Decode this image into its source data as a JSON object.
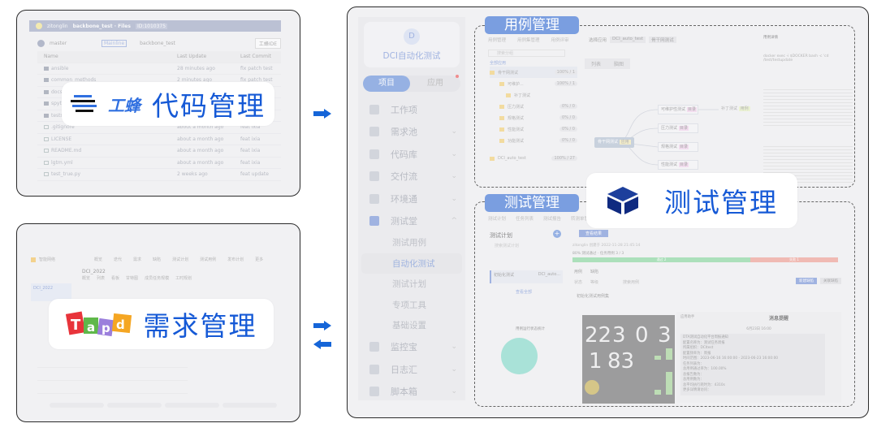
{
  "code_panel": {
    "breadcrumb": {
      "user": "zitonglin",
      "repo": "backbone_test · Files",
      "id": "ID:1010375"
    },
    "branch": "master",
    "branch_tag": "Mainline",
    "path": "backbone_test",
    "ide_button": "工蜂IDE",
    "columns": [
      "Name",
      "Last Update",
      "Last Commit"
    ],
    "commit_hash": "e40f",
    "files": [
      {
        "name": "ansible",
        "type": "folder",
        "updated": "28 minutes ago",
        "commit": "fix patch test"
      },
      {
        "name": "common_methods",
        "type": "folder",
        "updated": "2 minutes ago",
        "commit": "fix patch test"
      },
      {
        "name": "docs",
        "type": "folder",
        "updated": "",
        "commit": ""
      },
      {
        "name": "spytest",
        "type": "folder",
        "updated": "",
        "commit": ""
      },
      {
        "name": "tests",
        "type": "folder",
        "updated": "",
        "commit": ""
      },
      {
        "name": ".gitignore",
        "type": "file",
        "updated": "about a month ago",
        "commit": "feat ixia"
      },
      {
        "name": "LICENSE",
        "type": "file",
        "updated": "about a month ago",
        "commit": "feat ixia"
      },
      {
        "name": "README.md",
        "type": "file",
        "updated": "about a month ago",
        "commit": "feat ixia"
      },
      {
        "name": "lgtm.yml",
        "type": "file",
        "updated": "about a month ago",
        "commit": "feat ixia"
      },
      {
        "name": "test_true.py",
        "type": "file",
        "updated": "2 weeks ago",
        "commit": "feat update"
      }
    ],
    "overlay": {
      "logo": "工蜂",
      "title": "代码管理"
    }
  },
  "req_panel": {
    "app_name": "智能网络",
    "nav": [
      "概览",
      "迭代",
      "需求",
      "缺陷",
      "测试计划",
      "测试用例",
      "发布计划",
      "更多"
    ],
    "sprint": "DCI_2022",
    "tabs": [
      "概览",
      "列表",
      "看板",
      "甘特图",
      "成员任务规模",
      "工时规划"
    ],
    "overlay": {
      "logo": "Tapd",
      "title": "需求管理"
    }
  },
  "platform": {
    "project_initial": "D",
    "project_name": "DCI自动化测试",
    "toggle": [
      "项目",
      "应用"
    ],
    "menu": [
      {
        "label": "工作项",
        "chevron": false
      },
      {
        "label": "需求池",
        "chevron": true
      },
      {
        "label": "代码库",
        "chevron": true
      },
      {
        "label": "交付流",
        "chevron": true
      },
      {
        "label": "环境通",
        "chevron": true
      },
      {
        "label": "测试堂",
        "chevron": true,
        "expanded": true
      }
    ],
    "submenu": [
      "测试用例",
      "自动化测试",
      "测试计划",
      "专项工具",
      "基础设置"
    ],
    "active_sub": "自动化测试",
    "menu_bottom": [
      "监控宝",
      "日志汇",
      "脚本箱"
    ],
    "accent": "#6f96dc"
  },
  "case_section": {
    "label": "用例管理",
    "tabs": [
      "用例管理",
      "用例集管理",
      "用例评审"
    ],
    "app_select_label": "选择应用",
    "app_chips": [
      "DCI_auto_test",
      "骨干网测试"
    ],
    "search_placeholder": "搜索分组",
    "all_apps": "全部应用",
    "tree": [
      {
        "name": "骨干网测试",
        "pct": "100% / 1"
      },
      {
        "name": "可维护...",
        "pct": "100% / 1"
      },
      {
        "name": "补丁测试",
        "pct": ""
      },
      {
        "name": "压力测试",
        "pct": "0% / 0"
      },
      {
        "name": "规格测试",
        "pct": "0% / 0"
      },
      {
        "name": "性能测试",
        "pct": "0% / 0"
      },
      {
        "name": "功能测试",
        "pct": "0% / 0"
      },
      {
        "name": "DCI_auto_test",
        "pct": "100% / 27"
      }
    ],
    "view_toggle": [
      "列表",
      "脑图"
    ],
    "mind_root": "骨干网测试",
    "root_tag": "应用",
    "mind_nodes": [
      "可维护性测试",
      "压力测试",
      "规格测试",
      "性能测试"
    ],
    "node_tag": "目录",
    "leaf": "补丁测试",
    "leaf_tag": "用例",
    "detail_title": "用例详情",
    "command": "docker exec -i $DOCKER bash -c 'cd /test/testupdate"
  },
  "test_section": {
    "label": "测试管理",
    "tabs": [
      "测试计划",
      "任务列表",
      "测试报告",
      "转测单管理"
    ],
    "plan_title": "测试计划",
    "search_placeholder": "搜索测试计划",
    "plan_item": "初始化测试",
    "plan_app": "DCI_auto...",
    "view_all": "查看全部",
    "run_button": "查看结果",
    "meta": "zitonglin 创建于 2022-11-28 21:45:14",
    "summary": "80% 测试通过 · 任务用例 3 / 3",
    "progress": {
      "pass_label": "通过 2",
      "fail_label": "失败 1",
      "pass_fraction": 0.67
    },
    "result_tabs": [
      "用例",
      "缺陷"
    ],
    "filters": [
      "状态",
      "等级"
    ],
    "search_case": "搜索用例",
    "buttons": [
      "新建缺陷",
      "关联缺陷"
    ],
    "case_list_title": "初始化测试用例集",
    "pie_title": "用例运行状态统计",
    "dashboard": [
      "22",
      "3",
      "0",
      "3",
      "1",
      "83"
    ],
    "message": {
      "back": "应用助手",
      "title": "消息提醒",
      "time": "6月23日 16:00",
      "lines": [
        "DTA测试自动化平台周报通知",
        "配置名称为：测试任务周报",
        "所属组织：DCItest",
        "配置频率为：周报",
        "时间范围：2023-06-16 16:00:00 - 2023-06-23 16:00:00",
        "任务列表为：",
        "总用例通过率为：100.00%",
        "总报告数为：",
        "总用例数为：",
        "总平均执行耗时为：4310s",
        "更多详情请访问："
      ]
    },
    "overlay": {
      "title": "测试管理"
    }
  },
  "colors": {
    "overlay_text": "#1559d6",
    "tag_bg": "#7a9ee0",
    "pass": "#8fd9a3",
    "fail": "#f0a397",
    "arrow": "#1565d8"
  }
}
